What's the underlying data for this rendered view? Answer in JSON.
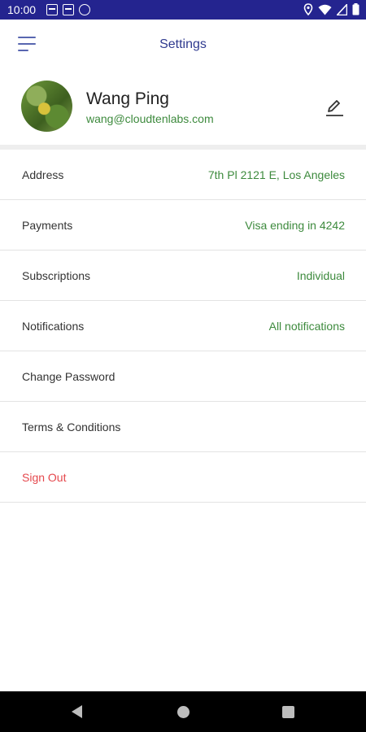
{
  "status_bar": {
    "time": "10:00",
    "left_icons": [
      "notification-icon",
      "notification-icon",
      "sync-icon"
    ],
    "right_icons": [
      "location-icon",
      "wifi-icon",
      "signal-icon",
      "battery-icon"
    ]
  },
  "header": {
    "title": "Settings",
    "menu_icon": "menu-icon"
  },
  "profile": {
    "name": "Wang Ping",
    "email": "wang@cloudtenlabs.com",
    "edit_icon": "edit-icon"
  },
  "settings": {
    "items": [
      {
        "label": "Address",
        "value": "7th Pl 2121 E, Los Angeles"
      },
      {
        "label": "Payments",
        "value": "Visa ending in 4242"
      },
      {
        "label": "Subscriptions",
        "value": "Individual"
      },
      {
        "label": "Notifications",
        "value": "All notifications"
      },
      {
        "label": "Change Password"
      },
      {
        "label": "Terms & Conditions"
      },
      {
        "label": "Sign Out"
      }
    ]
  },
  "colors": {
    "status_bar": "#24248f",
    "accent": "#2f3a8f",
    "value_green": "#3d8a3d",
    "danger": "#e5484d"
  },
  "nav_bar": {
    "icons": [
      "back-icon",
      "home-icon",
      "recents-icon"
    ]
  }
}
